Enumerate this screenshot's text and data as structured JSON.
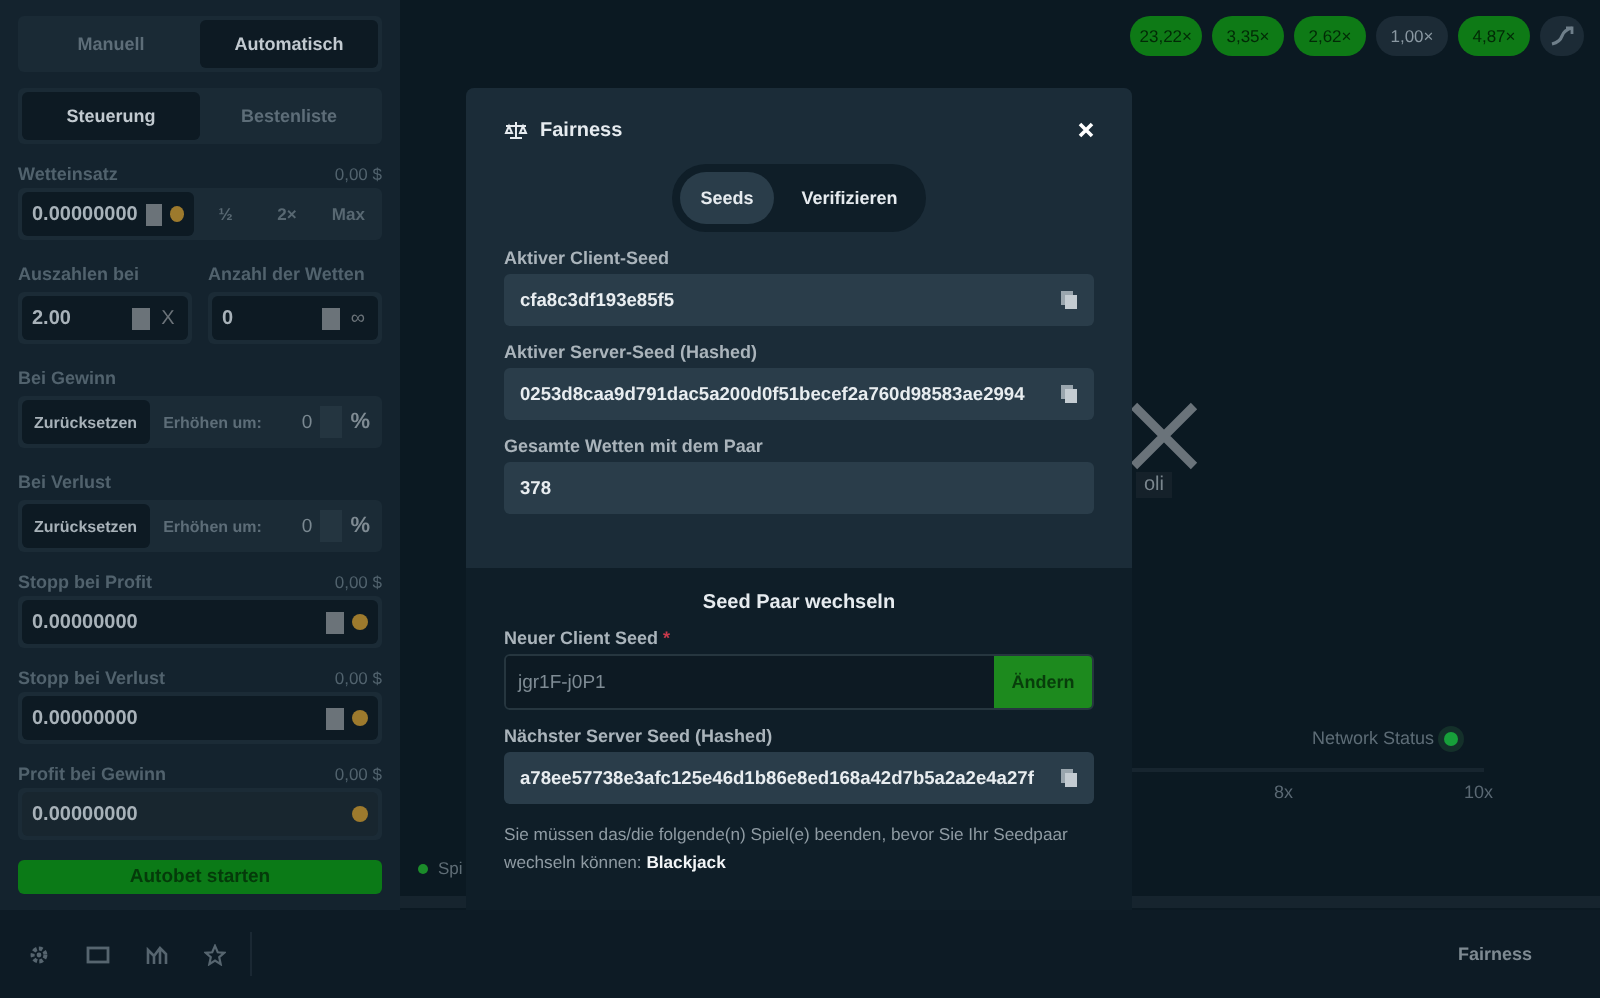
{
  "mode_tabs": [
    {
      "label": "Manuell",
      "selected": false
    },
    {
      "label": "Automatisch",
      "selected": true
    }
  ],
  "sub_tabs": [
    {
      "label": "Steuerung",
      "selected": true
    },
    {
      "label": "Bestenliste",
      "selected": false
    }
  ],
  "bet_amount": {
    "label": "Wetteinsatz",
    "usd": "0,00 $",
    "value": "0.00000000",
    "buttons": [
      "½",
      "2×",
      "Max"
    ]
  },
  "payout": {
    "label": "Auszahlen bei",
    "value": "2.00",
    "suffix": "X"
  },
  "bet_count": {
    "label": "Anzahl der Wetten",
    "value": "0",
    "suffix": "∞"
  },
  "on_win": {
    "label": "Bei Gewinn",
    "options": [
      {
        "label": "Zurücksetzen",
        "selected": true
      },
      {
        "label": "Erhöhen um:",
        "selected": false
      }
    ],
    "value": "0",
    "unit": "%"
  },
  "on_loss": {
    "label": "Bei Verlust",
    "options": [
      {
        "label": "Zurücksetzen",
        "selected": true
      },
      {
        "label": "Erhöhen um:",
        "selected": false
      }
    ],
    "value": "0",
    "unit": "%"
  },
  "stop_profit": {
    "label": "Stopp bei Profit",
    "usd": "0,00 $",
    "value": "0.00000000",
    "disabled": false
  },
  "stop_loss": {
    "label": "Stopp bei Verlust",
    "usd": "0,00 $",
    "value": "0.00000000",
    "disabled": false
  },
  "profit_on_win": {
    "label": "Profit bei Gewinn",
    "usd": "0,00 $",
    "value": "0.00000000",
    "disabled": true
  },
  "start_button": "Autobet starten",
  "multiplier_history": [
    {
      "label": "23,22×",
      "color": "#0e7a16"
    },
    {
      "label": "3,35×",
      "color": "#0e7a16"
    },
    {
      "label": "2,62×",
      "color": "#0e7a16"
    },
    {
      "label": "1,00×",
      "color": "#1c2b36"
    },
    {
      "label": "4,87×",
      "color": "#0e7a16"
    }
  ],
  "game": {
    "partial_label": "oli",
    "game_label": "Spi",
    "network_status": "Network Status",
    "axis_labels": [
      "8x",
      "10x"
    ]
  },
  "footer": {
    "fairness_link": "Fairness"
  },
  "modal": {
    "title": "Fairness",
    "tabs": [
      {
        "label": "Seeds",
        "selected": true
      },
      {
        "label": "Verifizieren",
        "selected": false
      }
    ],
    "fields": [
      {
        "label": "Aktiver Client-Seed",
        "value": "cfa8c3df193e85f5",
        "copyable": true
      },
      {
        "label": "Aktiver Server-Seed (Hashed)",
        "value": "0253d8caa9d791dac5a200d0f51becef2a760d98583ae2994",
        "copyable": true
      },
      {
        "label": "Gesamte Wetten mit dem Paar",
        "value": "378",
        "copyable": false
      }
    ],
    "section_title": "Seed Paar wechseln",
    "new_seed": {
      "label": "Neuer Client Seed",
      "required": "*",
      "value": "jgr1F-j0P1",
      "button": "Ändern"
    },
    "next_seed": {
      "label": "Nächster Server Seed (Hashed)",
      "value": "a78ee57738e3afc125e46d1b86e8ed168a42d7b5a2a2e4a27f"
    },
    "note": "Sie müssen das/die folgende(n) Spiel(e) beenden, bevor Sie Ihr Seedpaar wechseln können: **Blackjack**"
  }
}
